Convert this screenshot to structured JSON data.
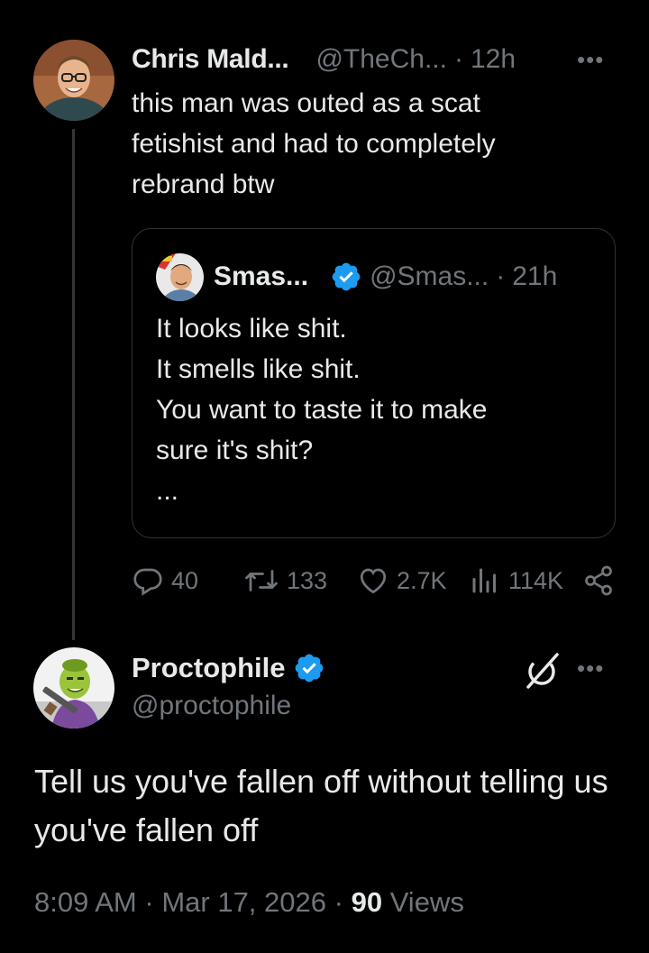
{
  "tweet1": {
    "author_name": "Chris Mald...",
    "handle": "@TheCh...",
    "time": "12h",
    "text": "this man was outed as a scat\nfetishist and had to completely\nrebrand btw",
    "more_icon": "more-horizontal-icon"
  },
  "quote": {
    "author_name": "Smas...",
    "handle": "@Smas...",
    "time": "21h",
    "verified": true,
    "text": "It looks like shit.\nIt smells like shit.\nYou want to taste it to make\nsure it's shit?\n..."
  },
  "actions": {
    "replies": "40",
    "reposts": "133",
    "likes": "2.7K",
    "views": "114K"
  },
  "tweet2": {
    "author_name": "Proctophile",
    "handle": "@proctophile",
    "verified": true,
    "text": "Tell us you've fallen off without telling us you've fallen off",
    "time": "8:09 AM",
    "date": "Mar 17, 2026",
    "views_count": "90",
    "views_label": "Views"
  },
  "separator": "·",
  "colors": {
    "background": "#000000",
    "text_primary": "#e7e9ea",
    "text_secondary": "#71767b",
    "verified_blue": "#1d9bf0",
    "border": "#2f3336"
  }
}
